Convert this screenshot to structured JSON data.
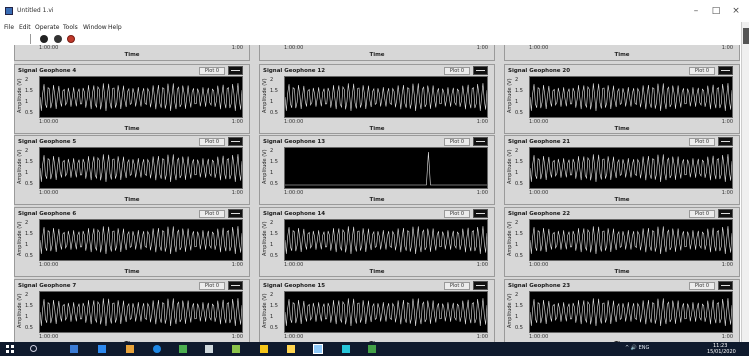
{
  "window": {
    "title": "Untitled 1.vi",
    "minimize_glyph": "–",
    "maximize_glyph": "□",
    "close_glyph": "×"
  },
  "menu": [
    "File",
    "Edit",
    "Operate",
    "Tools",
    "Window",
    "Help"
  ],
  "toolbar": {
    "buttons": [
      {
        "name": "run-icon"
      },
      {
        "name": "run-continuously-icon"
      },
      {
        "name": "abort-icon",
        "color": "#c0392b"
      }
    ]
  },
  "panels": [
    {
      "name": "Signal Geophone 4",
      "plot_button": "Plot 0",
      "ylabel": "Amplitude (V)",
      "yticks": [
        "2",
        "1.5",
        "1",
        "0.5"
      ],
      "x_start": "1:00:00",
      "x_end": "1:00",
      "xlabel": "Time",
      "waveform": "dense"
    },
    {
      "name": "Signal Geophone 12",
      "plot_button": "Plot 0",
      "ylabel": "Amplitude (V)",
      "yticks": [
        "2",
        "1.5",
        "1",
        "0.5"
      ],
      "x_start": "1:00:00",
      "x_end": "1:00",
      "xlabel": "Time",
      "waveform": "dense"
    },
    {
      "name": "Signal Geophone 20",
      "plot_button": "Plot 0",
      "ylabel": "Amplitude (V)",
      "yticks": [
        "2",
        "1.5",
        "1",
        "0.5"
      ],
      "x_start": "1:00:00",
      "x_end": "1:00",
      "xlabel": "Time",
      "waveform": "dense"
    },
    {
      "name": "Signal Geophone 5",
      "plot_button": "Plot 0",
      "ylabel": "Amplitude (V)",
      "yticks": [
        "2",
        "1.5",
        "1",
        "0.5"
      ],
      "x_start": "1:00:00",
      "x_end": "1:00",
      "xlabel": "Time",
      "waveform": "dense"
    },
    {
      "name": "Signal Geophone 13",
      "plot_button": "Plot 0",
      "ylabel": "Amplitude (V)",
      "yticks": [
        "2",
        "1.5",
        "1",
        "0.5"
      ],
      "x_start": "1:00:00",
      "x_end": "1:00",
      "xlabel": "Time",
      "waveform": "spike"
    },
    {
      "name": "Signal Geophone 21",
      "plot_button": "Plot 0",
      "ylabel": "Amplitude (V)",
      "yticks": [
        "2",
        "1.5",
        "1",
        "0.5"
      ],
      "x_start": "1:00:00",
      "x_end": "1:00",
      "xlabel": "Time",
      "waveform": "dense"
    },
    {
      "name": "Signal Geophone 6",
      "plot_button": "Plot 0",
      "ylabel": "Amplitude (V)",
      "yticks": [
        "2",
        "1.5",
        "1",
        "0.5"
      ],
      "x_start": "1:00:00",
      "x_end": "1:00",
      "xlabel": "Time",
      "waveform": "dense"
    },
    {
      "name": "Signal Geophone 14",
      "plot_button": "Plot 0",
      "ylabel": "Amplitude (V)",
      "yticks": [
        "2",
        "1.5",
        "1",
        "0.5"
      ],
      "x_start": "1:00:00",
      "x_end": "1:00",
      "xlabel": "Time",
      "waveform": "dense"
    },
    {
      "name": "Signal Geophone 22",
      "plot_button": "Plot 0",
      "ylabel": "Amplitude (V)",
      "yticks": [
        "2",
        "1.5",
        "1",
        "0.5"
      ],
      "x_start": "1:00:00",
      "x_end": "1:00",
      "xlabel": "Time",
      "waveform": "dense"
    },
    {
      "name": "Signal Geophone 7",
      "plot_button": "Plot 0",
      "ylabel": "Amplitude (V)",
      "yticks": [
        "2",
        "1.5",
        "1",
        "0.5"
      ],
      "x_start": "1:00:00",
      "x_end": "1:00",
      "xlabel": "Time",
      "waveform": "dense"
    },
    {
      "name": "Signal Geophone 15",
      "plot_button": "Plot 0",
      "ylabel": "Amplitude (V)",
      "yticks": [
        "2",
        "1.5",
        "1",
        "0.5"
      ],
      "x_start": "1:00:00",
      "x_end": "1:00",
      "xlabel": "Time",
      "waveform": "dense"
    },
    {
      "name": "Signal Geophone 23",
      "plot_button": "Plot 0",
      "ylabel": "Amplitude (V)",
      "yticks": [
        "2",
        "1.5",
        "1",
        "0.5"
      ],
      "x_start": "1:00:00",
      "x_end": "1:00",
      "xlabel": "Time",
      "waveform": "dense"
    }
  ],
  "partial_rows": [
    {
      "xlabel": "Time",
      "x_start": "1:00:00",
      "x_end": "1:00"
    },
    {
      "xlabel": "Time",
      "x_start": "1:00:00",
      "x_end": "1:00"
    },
    {
      "xlabel": "Time",
      "x_start": "1:00:00",
      "x_end": "1:00"
    }
  ],
  "taskbar": {
    "tray_text": "^ 🔊 ENG",
    "time": "11:23",
    "date": "15/01/2020"
  },
  "colors": {
    "plot_background": "#000000",
    "trace": "#e6e6e6",
    "panel_background": "#d7d7d7",
    "taskbar": "#0f1a2d"
  }
}
